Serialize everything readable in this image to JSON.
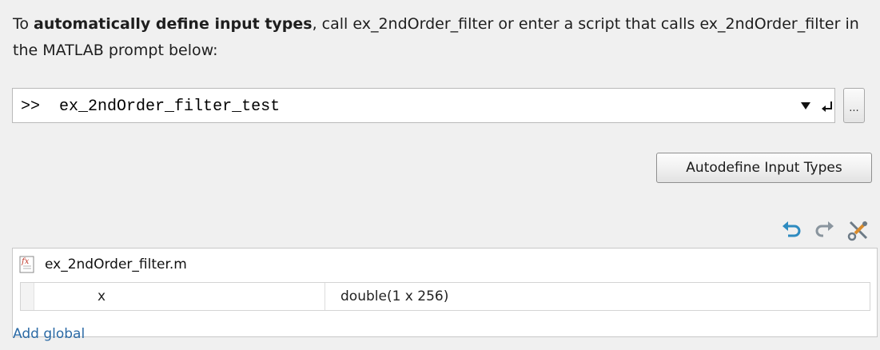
{
  "instructions": {
    "prefix": "To ",
    "bold": "automatically define input types",
    "suffix": ", call ex_2ndOrder_filter or enter a script that calls ex_2ndOrder_filter in the MATLAB prompt below:"
  },
  "prompt": {
    "symbol": ">>",
    "value": "ex_2ndOrder_filter_test",
    "icons": {
      "dropdown": "dropdown-arrow-icon",
      "enter": "enter-return-icon"
    },
    "ellipsis_label": "..."
  },
  "autodefine_button": {
    "label": "Autodefine Input Types"
  },
  "toolbar": {
    "icons": [
      "undo-icon",
      "redo-icon",
      "tools-icon"
    ]
  },
  "entry_point": {
    "file_name": "ex_2ndOrder_filter.m",
    "icon": "function-file-icon",
    "variables": [
      {
        "name": "x",
        "type": "double(1 x 256)"
      }
    ]
  },
  "add_global_label": "Add global",
  "colors": {
    "link": "#2b6aa5",
    "background": "#f0f0f0",
    "icon_blue": "#2e8bc0",
    "icon_gray": "#7f8c97"
  }
}
